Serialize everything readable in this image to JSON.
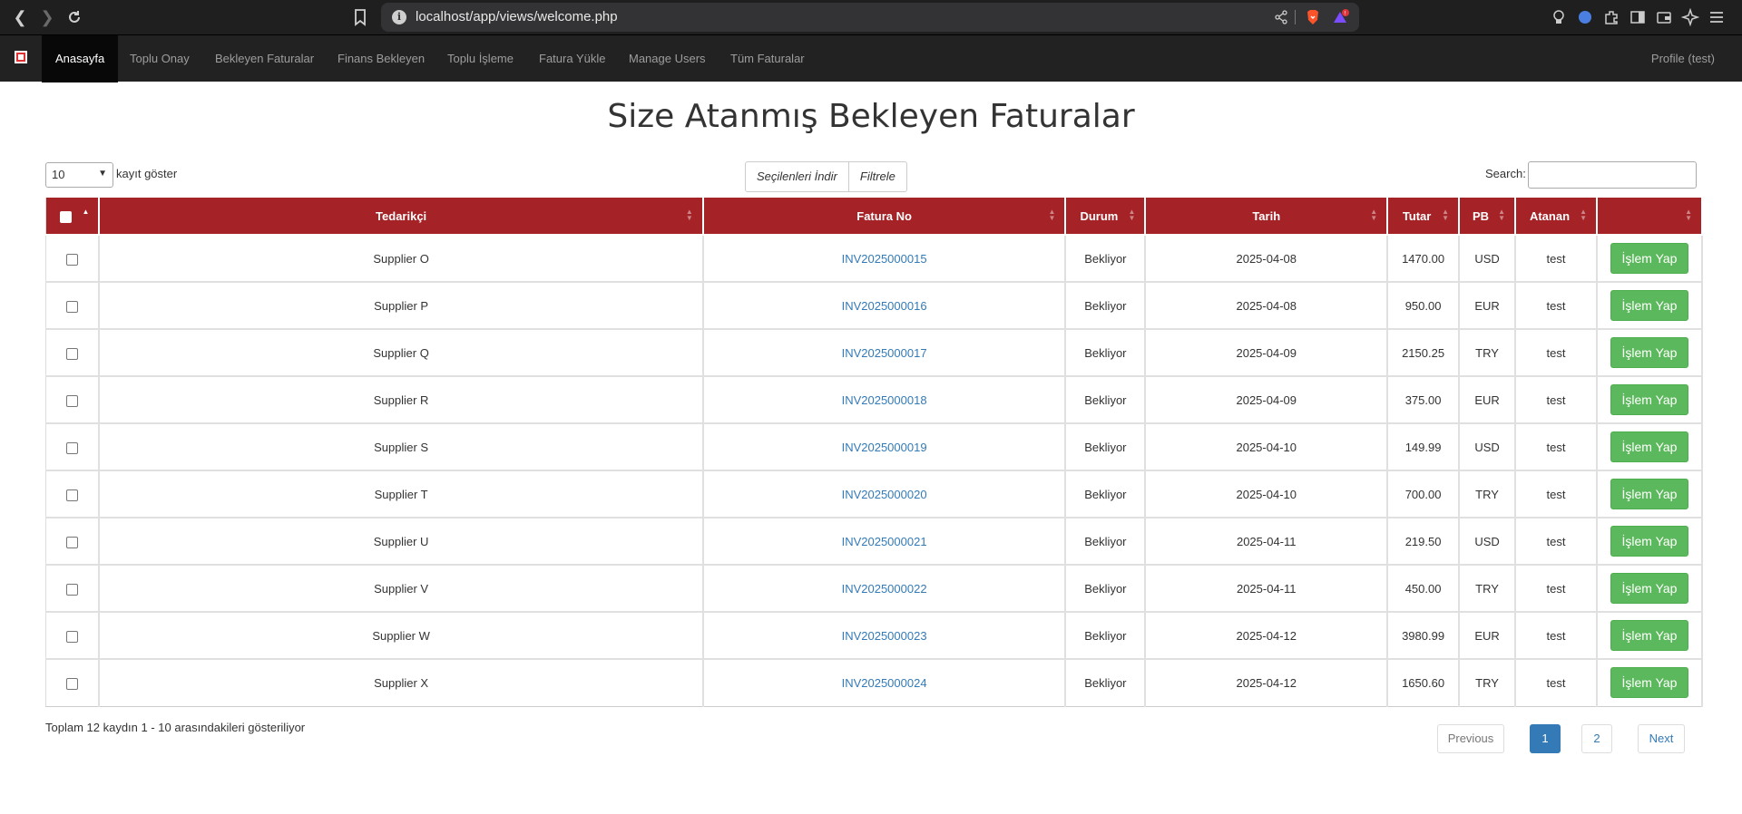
{
  "browser": {
    "url": "localhost/app/views/welcome.php",
    "rewards_badge": "!"
  },
  "navbar": {
    "items": [
      {
        "label": "Anasayfa",
        "active": true
      },
      {
        "label": "Toplu Onay"
      },
      {
        "label": "Bekleyen Faturalar"
      },
      {
        "label": "Finans Bekleyen"
      },
      {
        "label": "Toplu İşleme"
      },
      {
        "label": "Fatura Yükle"
      },
      {
        "label": "Manage Users"
      },
      {
        "label": "Tüm Faturalar"
      }
    ],
    "profile": "Profile (test)"
  },
  "page": {
    "title": "Size Atanmış Bekleyen Faturalar"
  },
  "controls": {
    "length_value": "10",
    "length_label": "kayıt göster",
    "download_selected": "Seçilenleri İndir",
    "filter": "Filtrele",
    "search_label": "Search:",
    "search_value": ""
  },
  "table": {
    "headers": [
      "Tedarikçi",
      "Fatura No",
      "Durum",
      "Tarih",
      "Tutar",
      "PB",
      "Atanan",
      ""
    ],
    "action_label": "İşlem Yap",
    "rows": [
      {
        "supplier": "Supplier O",
        "invoice": "INV2025000015",
        "status": "Bekliyor",
        "date": "2025-04-08",
        "amount": "1470.00",
        "currency": "USD",
        "assignee": "test"
      },
      {
        "supplier": "Supplier P",
        "invoice": "INV2025000016",
        "status": "Bekliyor",
        "date": "2025-04-08",
        "amount": "950.00",
        "currency": "EUR",
        "assignee": "test"
      },
      {
        "supplier": "Supplier Q",
        "invoice": "INV2025000017",
        "status": "Bekliyor",
        "date": "2025-04-09",
        "amount": "2150.25",
        "currency": "TRY",
        "assignee": "test"
      },
      {
        "supplier": "Supplier R",
        "invoice": "INV2025000018",
        "status": "Bekliyor",
        "date": "2025-04-09",
        "amount": "375.00",
        "currency": "EUR",
        "assignee": "test"
      },
      {
        "supplier": "Supplier S",
        "invoice": "INV2025000019",
        "status": "Bekliyor",
        "date": "2025-04-10",
        "amount": "149.99",
        "currency": "USD",
        "assignee": "test"
      },
      {
        "supplier": "Supplier T",
        "invoice": "INV2025000020",
        "status": "Bekliyor",
        "date": "2025-04-10",
        "amount": "700.00",
        "currency": "TRY",
        "assignee": "test"
      },
      {
        "supplier": "Supplier U",
        "invoice": "INV2025000021",
        "status": "Bekliyor",
        "date": "2025-04-11",
        "amount": "219.50",
        "currency": "USD",
        "assignee": "test"
      },
      {
        "supplier": "Supplier V",
        "invoice": "INV2025000022",
        "status": "Bekliyor",
        "date": "2025-04-11",
        "amount": "450.00",
        "currency": "TRY",
        "assignee": "test"
      },
      {
        "supplier": "Supplier W",
        "invoice": "INV2025000023",
        "status": "Bekliyor",
        "date": "2025-04-12",
        "amount": "3980.99",
        "currency": "EUR",
        "assignee": "test"
      },
      {
        "supplier": "Supplier X",
        "invoice": "INV2025000024",
        "status": "Bekliyor",
        "date": "2025-04-12",
        "amount": "1650.60",
        "currency": "TRY",
        "assignee": "test"
      }
    ]
  },
  "footer": {
    "info": "Toplam 12 kaydın 1 - 10 arasındakileri gösteriliyor",
    "previous": "Previous",
    "page1": "1",
    "page2": "2",
    "next": "Next"
  },
  "colors": {
    "header_red": "#a52226",
    "action_green": "#5cb85c",
    "link_blue": "#337ab7",
    "navbar_bg": "#222222"
  }
}
